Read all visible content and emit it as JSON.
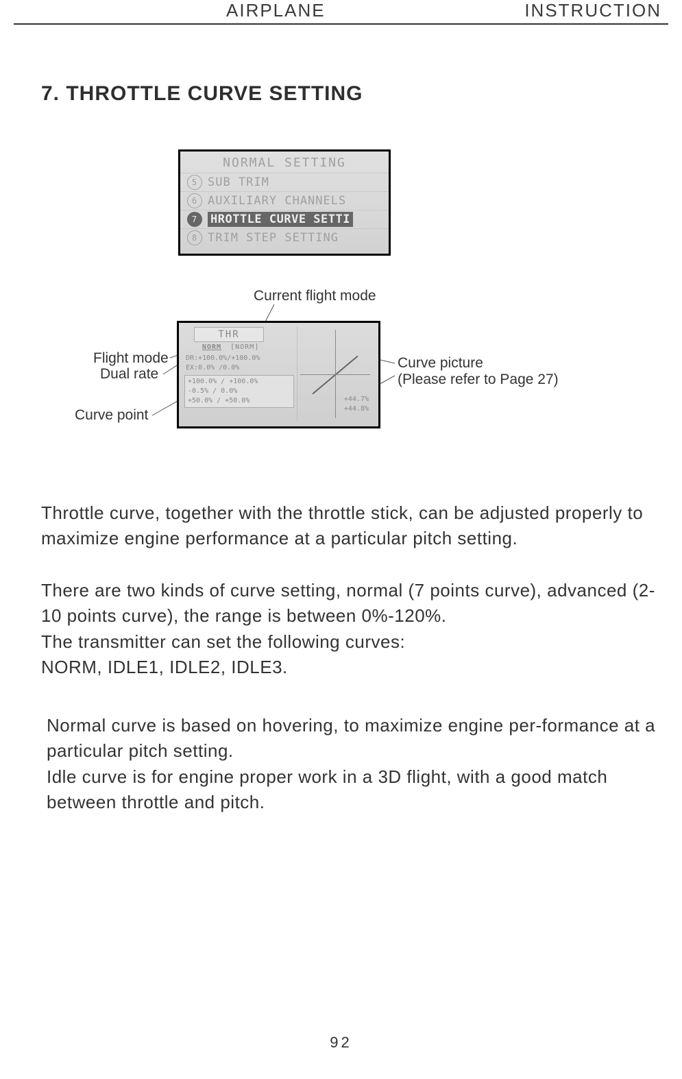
{
  "header": {
    "left": "AIRPLANE",
    "right": "INSTRUCTION"
  },
  "heading": "7. THROTTLE CURVE SETTING",
  "lcd1": {
    "title": "NORMAL SETTING",
    "rows": [
      {
        "num": "5",
        "text": "SUB TRIM",
        "selected": false
      },
      {
        "num": "6",
        "text": "AUXILIARY CHANNELS",
        "selected": false
      },
      {
        "num": "7",
        "text": "HROTTLE CURVE SETTI",
        "selected": true
      },
      {
        "num": "8",
        "text": "TRIM STEP SETTING",
        "selected": false
      }
    ]
  },
  "callouts": {
    "current_flight_mode": "Current flight mode",
    "flight_mode": "Flight mode",
    "dual_rate": "Dual rate",
    "curve_point": "Curve point",
    "curve_picture_l1": "Curve picture",
    "curve_picture_l2": "(Please refer to Page 27)"
  },
  "lcd2": {
    "tab": "THR",
    "mode_norm1": "NORM",
    "mode_norm2": "[NORM]",
    "dr": "DR:+100.0%/+100.0%",
    "ex": "EX:0.0%  /0.0%",
    "point1": "+100.0% / +100.0%",
    "point2": "-0.5%  / 0.0%",
    "point3": "+50.0% / +50.0%",
    "graph_v1": "+44.7%",
    "graph_v2": "+44.8%"
  },
  "paragraphs": {
    "p1": "Throttle curve, together with the throttle stick, can be adjusted properly to maximize engine performance at a particular pitch setting.",
    "p2": "There are two kinds of curve setting, normal (7 points curve), advanced (2-10 points curve), the range is between 0%-120%.",
    "p3": "The transmitter can set the following curves:",
    "p4": "NORM, IDLE1, IDLE2, IDLE3.",
    "p5": "Normal curve is based on hovering, to maximize engine per-formance at a particular pitch setting.",
    "p6": "Idle curve is for engine proper work in a 3D flight, with a good match between throttle and pitch."
  },
  "page_number": "92"
}
